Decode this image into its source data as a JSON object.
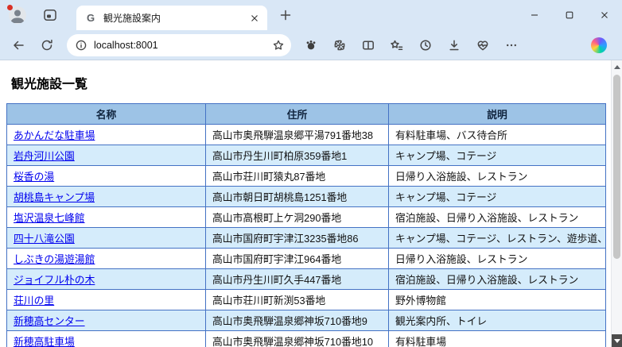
{
  "browser": {
    "tab": {
      "favicon_letter": "G",
      "title": "観光施設案内"
    },
    "address_bar": {
      "url": "localhost:8001"
    }
  },
  "page": {
    "heading": "観光施設一覧",
    "table": {
      "headers": [
        "名称",
        "住所",
        "説明"
      ],
      "rows": [
        {
          "name": "あかんだな駐車場",
          "address": "高山市奥飛騨温泉郷平湯791番地38",
          "description": "有料駐車場、バス待合所"
        },
        {
          "name": "岩舟河川公園",
          "address": "高山市丹生川町柏原359番地1",
          "description": "キャンプ場、コテージ"
        },
        {
          "name": "桜香の湯",
          "address": "高山市荘川町猿丸87番地",
          "description": "日帰り入浴施設、レストラン"
        },
        {
          "name": "胡桃島キャンプ場",
          "address": "高山市朝日町胡桃島1251番地",
          "description": "キャンプ場、コテージ"
        },
        {
          "name": "塩沢温泉七峰館",
          "address": "高山市高根町上ケ洞290番地",
          "description": "宿泊施設、日帰り入浴施設、レストラン"
        },
        {
          "name": "四十八滝公園",
          "address": "高山市国府町宇津江3235番地86",
          "description": "キャンプ場、コテージ、レストラン、遊歩道、"
        },
        {
          "name": "しぶきの湯遊湯館",
          "address": "高山市国府町宇津江964番地",
          "description": "日帰り入浴施設、レストラン"
        },
        {
          "name": "ジョイフル朴の木",
          "address": "高山市丹生川町久手447番地",
          "description": "宿泊施設、日帰り入浴施設、レストラン"
        },
        {
          "name": "荘川の里",
          "address": "高山市荘川町新渕53番地",
          "description": "野外博物館"
        },
        {
          "name": "新穂高センター",
          "address": "高山市奥飛騨温泉郷神坂710番地9",
          "description": "観光案内所、トイレ"
        },
        {
          "name": "新穂高駐車場",
          "address": "高山市奥飛騨温泉郷神坂710番地10",
          "description": "有料駐車場"
        }
      ]
    }
  },
  "colors": {
    "chrome_bg": "#d9e7f6",
    "page_bg": "#ffffff",
    "table_border": "#4472c4",
    "table_header_bg": "#9dc3e6",
    "table_alt_row_bg": "#d5ecfb",
    "link": "#0000ee",
    "scrollbar_track": "#f5f6f8",
    "scrollbar_thumb": "#c6c6c6",
    "scrollbar_down_btn": "#4c4c4c"
  }
}
